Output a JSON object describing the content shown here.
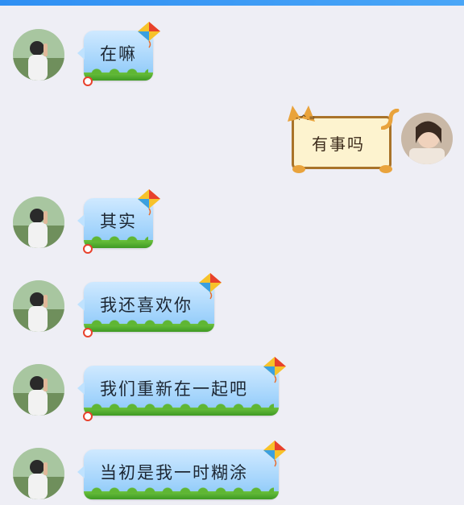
{
  "colors": {
    "background": "#eeeef5",
    "top_bar": "#2f8ff3",
    "bubble_sky": "#9fd2fb",
    "bubble_grass": "#4fae2d",
    "cat_bubble_fill": "#fdf3cf",
    "cat_bubble_border": "#a9732a"
  },
  "messages": [
    {
      "side": "left",
      "text": "在嘛",
      "avatar_icon": "boy-avatar-icon",
      "bubble_style": "kite"
    },
    {
      "side": "right",
      "text": "有事吗",
      "avatar_icon": "girl-avatar-icon",
      "bubble_style": "cat"
    },
    {
      "side": "left",
      "text": "其实",
      "avatar_icon": "boy-avatar-icon",
      "bubble_style": "kite"
    },
    {
      "side": "left",
      "text": "我还喜欢你",
      "avatar_icon": "boy-avatar-icon",
      "bubble_style": "kite"
    },
    {
      "side": "left",
      "text": "我们重新在一起吧",
      "avatar_icon": "boy-avatar-icon",
      "bubble_style": "kite"
    },
    {
      "side": "left",
      "text": "当初是我一时糊涂",
      "avatar_icon": "boy-avatar-icon",
      "bubble_style": "kite"
    }
  ]
}
